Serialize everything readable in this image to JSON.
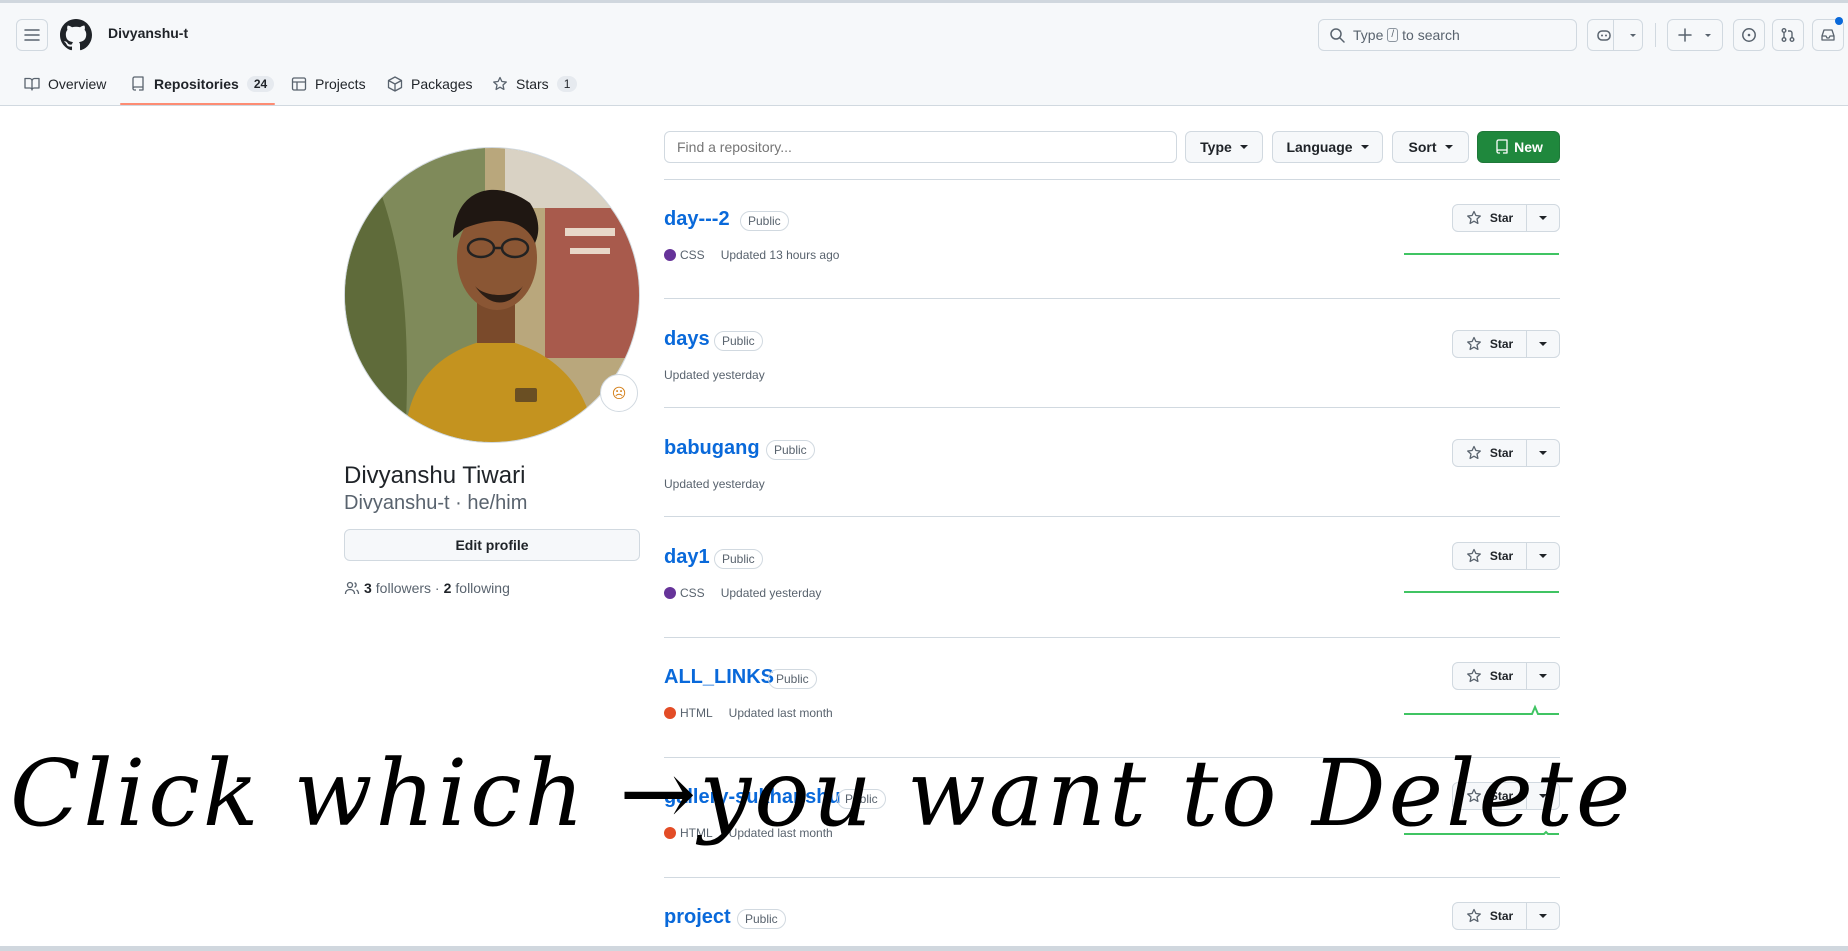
{
  "header": {
    "username": "Divyanshu-t",
    "search_prefix": "Type",
    "search_key": "/",
    "search_suffix": "to search"
  },
  "tabs": [
    {
      "label": "Overview",
      "icon": "book-icon"
    },
    {
      "label": "Repositories",
      "count": "24",
      "icon": "repo-icon"
    },
    {
      "label": "Projects",
      "icon": "table-icon"
    },
    {
      "label": "Packages",
      "icon": "package-icon"
    },
    {
      "label": "Stars",
      "count": "1",
      "icon": "star-icon"
    }
  ],
  "profile": {
    "full_name": "Divyanshu Tiwari",
    "handle": "Divyanshu-t · he/him",
    "edit_label": "Edit profile",
    "followers_count": "3",
    "followers_label": "followers ·",
    "following_count": "2",
    "following_label": "following",
    "status_emoji": "☹"
  },
  "filters": {
    "find_placeholder": "Find a repository...",
    "type_label": "Type",
    "language_label": "Language",
    "sort_label": "Sort",
    "new_label": "New"
  },
  "repos": [
    {
      "name": "day---2",
      "visibility": "Public",
      "language": "CSS",
      "lang_color": "#663399",
      "updated": "Updated 13 hours ago",
      "star": "Star"
    },
    {
      "name": "days",
      "visibility": "Public",
      "language": "",
      "updated": "Updated yesterday",
      "star": "Star"
    },
    {
      "name": "babugang",
      "visibility": "Public",
      "language": "",
      "updated": "Updated yesterday",
      "star": "Star"
    },
    {
      "name": "day1",
      "visibility": "Public",
      "language": "CSS",
      "lang_color": "#663399",
      "updated": "Updated yesterday",
      "star": "Star"
    },
    {
      "name": "ALL_LINKS",
      "visibility": "Public",
      "language": "HTML",
      "lang_color": "#e34c26",
      "updated": "Updated last month",
      "star": "Star"
    },
    {
      "name": "gallery-sukhanshu",
      "visibility": "Public",
      "language": "HTML",
      "lang_color": "#e34c26",
      "updated": "Updated last month",
      "star": "Star"
    },
    {
      "name": "project",
      "visibility": "Public",
      "language": "",
      "updated": "",
      "star": "Star"
    }
  ],
  "annotation": {
    "text": "Click which →you want to Delete"
  },
  "colors": {
    "link": "#0969da",
    "accent_underline": "#fd8c73",
    "new_button": "#1f883d",
    "spark": "#40c463"
  }
}
